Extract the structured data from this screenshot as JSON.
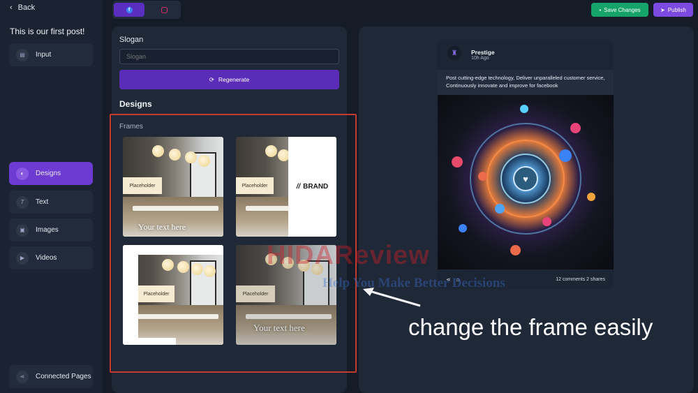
{
  "sidebar": {
    "back_label": "Back",
    "post_title": "This is our first post!",
    "items": [
      {
        "label": "Input",
        "icon": "document-icon",
        "active": false
      },
      {
        "label": "Designs",
        "icon": "palette-icon",
        "active": true
      },
      {
        "label": "Text",
        "icon": "text-icon",
        "active": false
      },
      {
        "label": "Images",
        "icon": "image-icon",
        "active": false
      },
      {
        "label": "Videos",
        "icon": "video-icon",
        "active": false
      }
    ],
    "connected_pages": "Connected Pages"
  },
  "topbar": {
    "tabs": [
      {
        "network": "facebook",
        "icon": "facebook-icon",
        "active": true
      },
      {
        "network": "instagram",
        "icon": "instagram-icon",
        "active": false
      }
    ],
    "save_label": "Save Changes",
    "publish_label": "Publish"
  },
  "editor": {
    "slogan_label": "Slogan",
    "slogan_placeholder": "Slogan",
    "regenerate_label": "Regenerate",
    "designs_heading": "Designs",
    "frames_label": "Frames",
    "frames": [
      {
        "placeholder": "Placeholder",
        "overlay_text": "Your text here"
      },
      {
        "placeholder": "Placeholder",
        "brand": "BRAND"
      },
      {
        "placeholder": "Placeholder"
      },
      {
        "placeholder": "Placeholder",
        "overlay_text": "Your text here"
      }
    ]
  },
  "preview": {
    "account_name": "Prestige",
    "time": "10h Ago",
    "post_text": "Post cutting-edge technology, Deliver unparalleled customer service, Continuously innovate and improve for facebook",
    "stats": "12 comments 2 shares"
  },
  "overlay": {
    "caption": "change the frame easily",
    "watermark_main": "HIDAReview",
    "watermark_sub": "Help You Make Better Decisions"
  },
  "colors": {
    "accent_purple": "#6d3bd2",
    "save_green": "#16a36a",
    "highlight_red": "#c13b2f"
  }
}
